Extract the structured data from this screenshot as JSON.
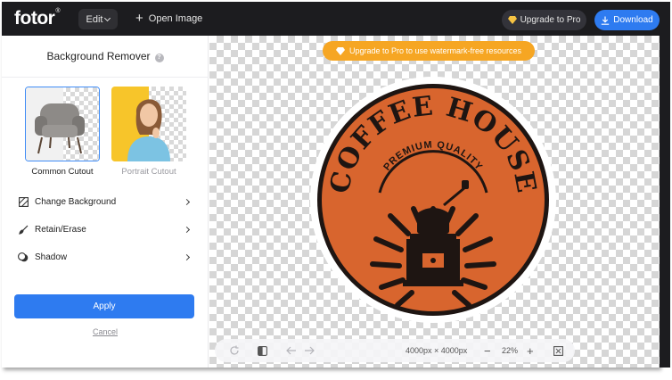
{
  "topbar": {
    "logo": "fotor",
    "logo_mark": "®",
    "edit_label": "Edit",
    "open_image_label": "Open Image",
    "upgrade_label": "Upgrade to Pro",
    "download_label": "Download"
  },
  "panel": {
    "title": "Background Remover",
    "help_glyph": "?",
    "cutouts": [
      {
        "label": "Common Cutout",
        "selected": true
      },
      {
        "label": "Portrait Cutout",
        "selected": false
      }
    ],
    "menu": [
      {
        "label": "Change Background",
        "icon": "background-icon"
      },
      {
        "label": "Retain/Erase",
        "icon": "brush-icon"
      },
      {
        "label": "Shadow",
        "icon": "shadow-icon"
      }
    ],
    "apply_label": "Apply",
    "cancel_label": "Cancel"
  },
  "canvas": {
    "banner": "Upgrade to Pro to use watermark-free resources",
    "artwork": {
      "title": "COFFEE HOUSE",
      "subtitle": "PREMIUM QUALITY"
    },
    "bottom_bar": {
      "dimensions": "4000px × 4000px",
      "zoom": "22%",
      "minus": "−",
      "plus": "+"
    }
  },
  "colors": {
    "accent": "#2e7bf0",
    "pro": "#f6a623",
    "topbar": "#1c1c1f",
    "coffee_orange": "#d8652e"
  }
}
